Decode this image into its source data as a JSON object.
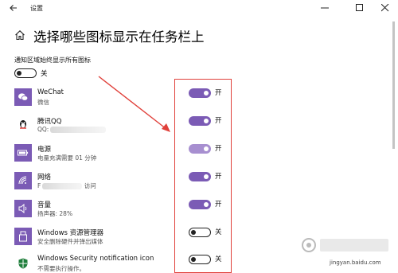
{
  "window": {
    "title": "设置"
  },
  "header": {
    "title": "选择哪些图标显示在任务栏上"
  },
  "notify": {
    "label": "通知区域始终显示所有图标",
    "state": "关"
  },
  "items": [
    {
      "name": "WeChat",
      "sub": "微信",
      "state": "开",
      "on": true,
      "icon": "wechat-icon"
    },
    {
      "name": "腾讯QQ",
      "sub": "QQ:",
      "state": "开",
      "on": true,
      "icon": "qq-icon"
    },
    {
      "name": "电源",
      "sub": "电量充满需要 01 分钟",
      "state": "开",
      "on": true,
      "icon": "battery-icon"
    },
    {
      "name": "网络",
      "sub": "F",
      "sub2": "访问",
      "state": "开",
      "on": true,
      "icon": "wifi-icon"
    },
    {
      "name": "音量",
      "sub": "扬声器: 28%",
      "state": "开",
      "on": true,
      "icon": "speaker-icon"
    },
    {
      "name": "Windows 资源管理器",
      "sub": "安全删除硬件并弹出媒体",
      "state": "关",
      "on": false,
      "icon": "usb-icon"
    },
    {
      "name": "Windows Security notification icon",
      "sub": "不需要执行操作。",
      "state": "关",
      "on": false,
      "icon": "shield-icon"
    }
  ],
  "watermark": {
    "text": "jingyan.baidu.com"
  },
  "colors": {
    "accent": "#7b5bb5",
    "annotation": "#e0403a"
  }
}
